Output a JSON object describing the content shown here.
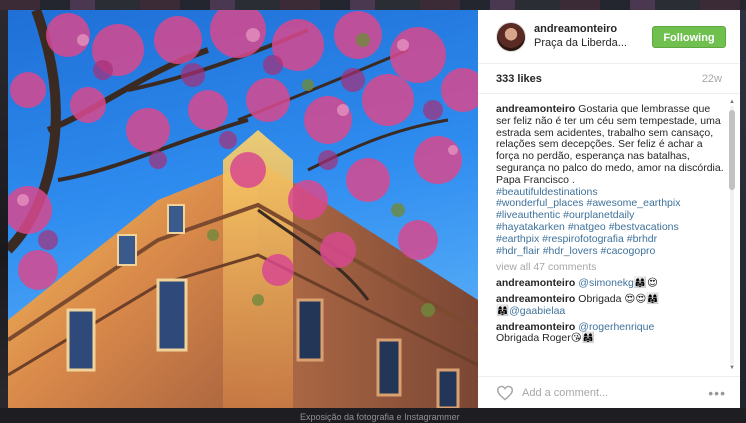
{
  "backdrop": {
    "caption_below": "Exposição da fotografia e Instagrammer"
  },
  "post": {
    "username": "andreamonteiro",
    "location": "Praça da Liberda...",
    "follow_label": "Following",
    "likes": "333 likes",
    "age": "22w",
    "caption_user": "andreamonteiro",
    "caption_text": "Gostaria que lembrasse que ser feliz não é ter um céu sem tempestade, uma estrada sem acidentes, trabalho sem cansaço, relações sem decepções. Ser feliz é achar a força no perdão, esperança nas batalhas, segurança no palco do medo, amor na discórdia.",
    "caption_signature": "Papa Francisco .",
    "hashtags": [
      "#beautifuldestinations",
      "#wonderful_places",
      "#awesome_earthpix",
      "#liveauthentic",
      "#ourplanetdaily",
      "#hayatakarken",
      "#natgeo",
      "#bestvacations",
      "#earthpix",
      "#respirofotografia",
      "#brhdr",
      "#hdr_flair",
      "#hdr_lovers",
      "#cacogopro"
    ],
    "view_all": "view all 47 comments",
    "comments": [
      {
        "user": "andreamonteiro",
        "mention": "@simonekg",
        "text": "👩‍👩‍👧😍"
      },
      {
        "user": "andreamonteiro",
        "mention": "",
        "text": "Obrigada 😍😍👩‍👩‍👧",
        "mention2": "👩‍👩‍👧@gaabielaa"
      },
      {
        "user": "andreamonteiro",
        "mention": "@rogerhenrique",
        "text": "",
        "tail": "Obrigada Roger😘👩‍👩‍👧"
      }
    ],
    "add_comment_placeholder": "Add a comment...",
    "more_label": "•••"
  },
  "icons": {
    "heart": "heart-outline-icon",
    "more": "more-dots-icon"
  },
  "colors": {
    "follow_bg": "#70c050",
    "link": "#3f729b",
    "muted": "#a5a7aa",
    "text": "#262626"
  }
}
